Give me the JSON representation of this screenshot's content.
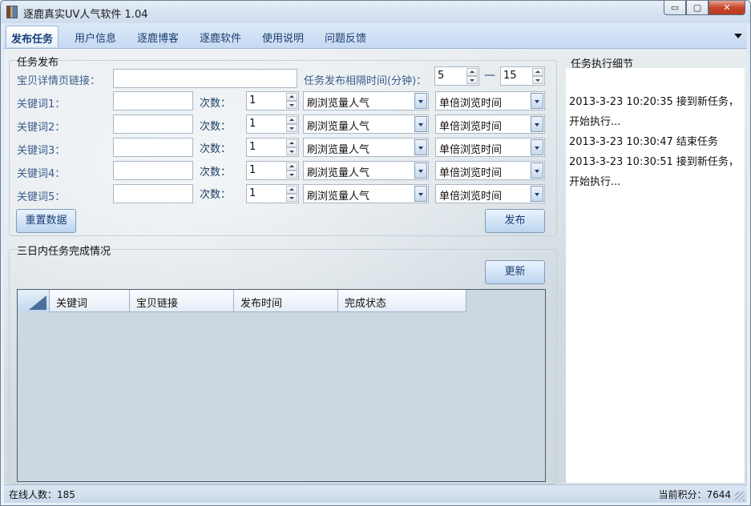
{
  "window": {
    "title": "逐鹿真实UV人气软件  1.04",
    "buttons": {
      "minimize": "▭",
      "maximize": "▢",
      "close": "✕"
    }
  },
  "tabs": [
    {
      "label": "发布任务",
      "active": true
    },
    {
      "label": "用户信息"
    },
    {
      "label": "逐鹿博客"
    },
    {
      "label": "逐鹿软件"
    },
    {
      "label": "使用说明"
    },
    {
      "label": "问题反馈"
    }
  ],
  "publish": {
    "group_title": "任务发布",
    "link_label": "宝贝详情页链接：",
    "link_value": "",
    "interval_label": "任务发布相隔时间(分钟)：",
    "interval_min": "5",
    "interval_dash": "—",
    "interval_max": "15",
    "count_label": "次数：",
    "keywords": [
      {
        "label": "关键词1：",
        "value": "",
        "count": "1",
        "mode": "刷浏览量人气",
        "time": "单倍浏览时间"
      },
      {
        "label": "关键词2：",
        "value": "",
        "count": "1",
        "mode": "刷浏览量人气",
        "time": "单倍浏览时间"
      },
      {
        "label": "关键词3：",
        "value": "",
        "count": "1",
        "mode": "刷浏览量人气",
        "time": "单倍浏览时间"
      },
      {
        "label": "关键词4：",
        "value": "",
        "count": "1",
        "mode": "刷浏览量人气",
        "time": "单倍浏览时间"
      },
      {
        "label": "关键词5：",
        "value": "",
        "count": "1",
        "mode": "刷浏览量人气",
        "time": "单倍浏览时间"
      }
    ],
    "reset_button": "重置数据",
    "publish_button": "发布"
  },
  "completion": {
    "group_title": "三日内任务完成情况",
    "refresh_button": "更新",
    "columns": [
      "关键词",
      "宝贝链接",
      "发布时间",
      "完成状态"
    ],
    "rows": []
  },
  "details": {
    "title": "任务执行细节",
    "log": [
      "2013-3-23 10:20:35    接到新任务，",
      "开始执行...",
      "2013-3-23 10:30:47    结束任务",
      "2013-3-23 10:30:51    接到新任务，",
      "开始执行..."
    ]
  },
  "status": {
    "online": "在线人数：185",
    "points": "当前积分：7644"
  }
}
